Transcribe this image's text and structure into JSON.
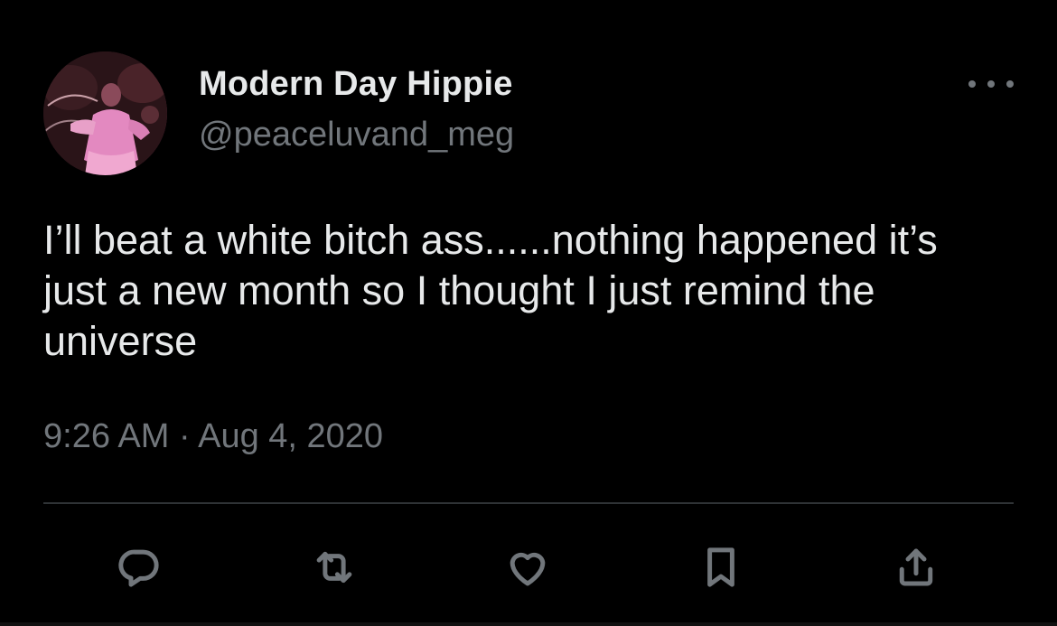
{
  "author": {
    "display_name": "Modern Day Hippie",
    "handle": "@peaceluvand_meg",
    "avatar": "profile-photo"
  },
  "tweet": {
    "text": "I’ll beat a white bitch ass......nothing happened it’s just a new month so I thought I just remind the universe",
    "time": "9:26 AM",
    "separator": "·",
    "date": "Aug 4, 2020"
  },
  "icons": {
    "more": "more-horizontal-icon",
    "reply": "reply-icon",
    "retweet": "retweet-icon",
    "like": "heart-icon",
    "bookmark": "bookmark-icon",
    "share": "share-icon"
  },
  "colors": {
    "background": "#000000",
    "primary_text": "#e7e9ea",
    "secondary_text": "#71767b",
    "divider": "#2f3336"
  }
}
